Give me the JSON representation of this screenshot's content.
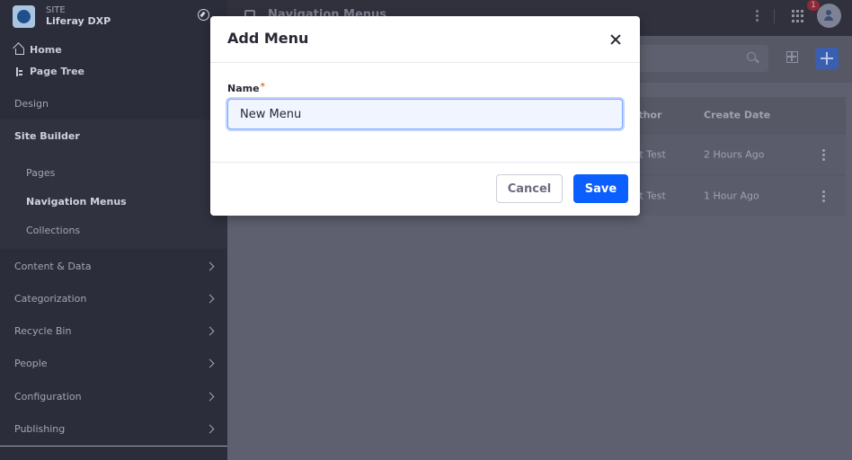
{
  "site": {
    "label": "SITE",
    "name": "Liferay DXP"
  },
  "quick_links": {
    "home": "Home",
    "page_tree": "Page Tree"
  },
  "sidebar": {
    "design": "Design",
    "site_builder": "Site Builder",
    "site_builder_items": [
      "Pages",
      "Navigation Menus",
      "Collections"
    ],
    "sections": [
      "Content & Data",
      "Categorization",
      "Recycle Bin",
      "People",
      "Configuration",
      "Publishing"
    ]
  },
  "topbar": {
    "title": "Navigation Menus",
    "notification_count": "1"
  },
  "table": {
    "headers": {
      "author": "Author",
      "create_date": "Create Date"
    },
    "rows": [
      {
        "author": "Test Test",
        "create_date": "2 Hours Ago"
      },
      {
        "author": "Test Test",
        "create_date": "1 Hour Ago"
      }
    ]
  },
  "modal": {
    "title": "Add Menu",
    "name_label": "Name",
    "required_marker": "*",
    "name_value": "New Menu",
    "cancel_label": "Cancel",
    "save_label": "Save"
  },
  "colors": {
    "primary": "#0b5fff",
    "required": "#e86d2c",
    "sidebar_bg": "#2b2d3a"
  }
}
